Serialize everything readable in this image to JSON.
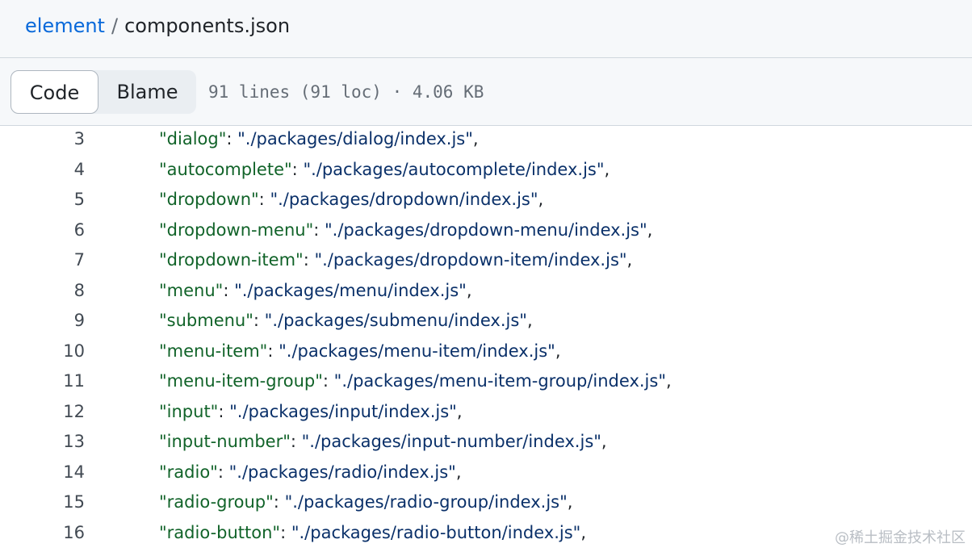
{
  "breadcrumb": {
    "repo": "element",
    "separator": "/",
    "file": "components.json"
  },
  "toolbar": {
    "code_label": "Code",
    "blame_label": "Blame",
    "file_info": "91 lines (91 loc) · 4.06 KB"
  },
  "code_lines": [
    {
      "num": "3",
      "key": "\"dialog\"",
      "value": "\"./packages/dialog/index.js\""
    },
    {
      "num": "4",
      "key": "\"autocomplete\"",
      "value": "\"./packages/autocomplete/index.js\""
    },
    {
      "num": "5",
      "key": "\"dropdown\"",
      "value": "\"./packages/dropdown/index.js\""
    },
    {
      "num": "6",
      "key": "\"dropdown-menu\"",
      "value": "\"./packages/dropdown-menu/index.js\""
    },
    {
      "num": "7",
      "key": "\"dropdown-item\"",
      "value": "\"./packages/dropdown-item/index.js\""
    },
    {
      "num": "8",
      "key": "\"menu\"",
      "value": "\"./packages/menu/index.js\""
    },
    {
      "num": "9",
      "key": "\"submenu\"",
      "value": "\"./packages/submenu/index.js\""
    },
    {
      "num": "10",
      "key": "\"menu-item\"",
      "value": "\"./packages/menu-item/index.js\""
    },
    {
      "num": "11",
      "key": "\"menu-item-group\"",
      "value": "\"./packages/menu-item-group/index.js\""
    },
    {
      "num": "12",
      "key": "\"input\"",
      "value": "\"./packages/input/index.js\""
    },
    {
      "num": "13",
      "key": "\"input-number\"",
      "value": "\"./packages/input-number/index.js\""
    },
    {
      "num": "14",
      "key": "\"radio\"",
      "value": "\"./packages/radio/index.js\""
    },
    {
      "num": "15",
      "key": "\"radio-group\"",
      "value": "\"./packages/radio-group/index.js\""
    },
    {
      "num": "16",
      "key": "\"radio-button\"",
      "value": "\"./packages/radio-button/index.js\""
    }
  ],
  "punctuation": {
    "colon": ": ",
    "comma": ","
  },
  "watermark": "@稀土掘金技术社区",
  "colors": {
    "link": "#0969da",
    "json_key": "#116329",
    "json_string": "#0a3069",
    "line_number": "#424a53"
  }
}
